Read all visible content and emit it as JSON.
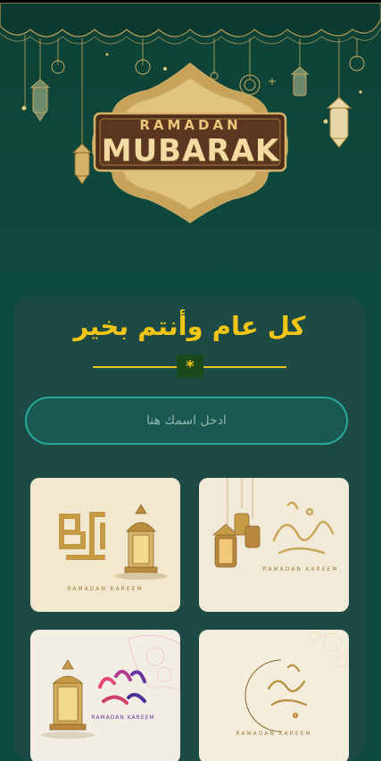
{
  "banner": {
    "small_text": "RAMADAN",
    "big_text": "MUBARAK"
  },
  "card": {
    "greeting": "كل عام وأنتم بخير",
    "divider_symbol": "*",
    "name_input": {
      "placeholder": "ادخل اسمك هنا",
      "value": ""
    }
  },
  "cards": [
    {
      "caption": "RAMADAN KAREEM"
    },
    {
      "caption": "RAMADAN KAREEM"
    },
    {
      "caption": "RAMADAN KAREEM"
    },
    {
      "caption": "RAMADAN KAREEM"
    }
  ],
  "colors": {
    "background": "#0f4a3f",
    "card": "#1d4a45",
    "gold": "#f2c514",
    "input_border": "#2aa79c"
  }
}
